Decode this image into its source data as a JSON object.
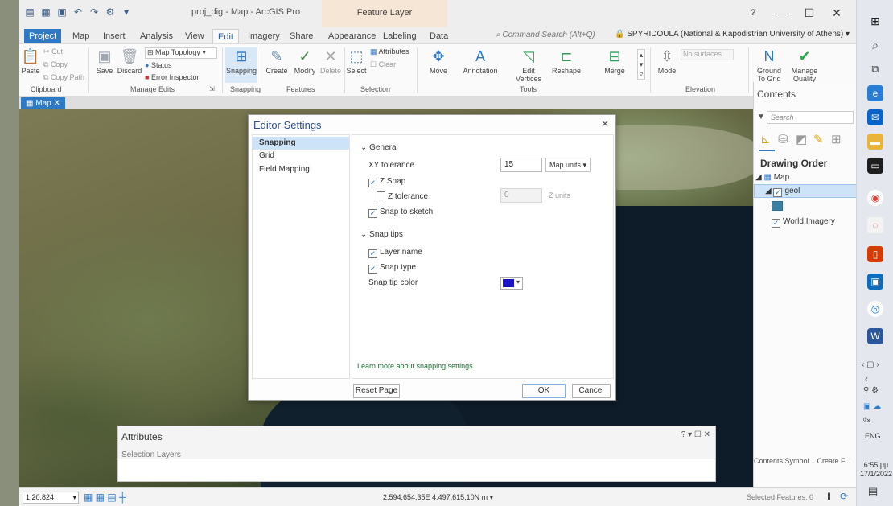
{
  "window": {
    "title": "proj_dig - Map - ArcGIS Pro",
    "context_title": "Feature Layer",
    "help": "?",
    "minimize": "—",
    "maximize": "☐",
    "close": "✕"
  },
  "ribbon_tabs": [
    "Project",
    "Map",
    "Insert",
    "Analysis",
    "View",
    "Edit",
    "Imagery",
    "Share",
    "Appearance",
    "Labeling",
    "Data"
  ],
  "command_search": "Command Search (Alt+Q)",
  "user": "SPYRIDOULA (National & Kapodistrian University of Athens) ▾",
  "ribbon": {
    "clipboard": {
      "paste": "Paste",
      "cut": "Cut",
      "copy": "Copy",
      "copy_path": "Copy Path",
      "group": "Clipboard"
    },
    "manage_edits": {
      "save": "Save",
      "discard": "Discard",
      "map_topology": "Map Topology",
      "status": "Status",
      "error_inspector": "Error Inspector",
      "group": "Manage Edits"
    },
    "snapping": {
      "label": "Snapping",
      "group": "Snapping"
    },
    "features": {
      "create": "Create",
      "modify": "Modify",
      "delete": "Delete",
      "group": "Features"
    },
    "selection": {
      "select": "Select",
      "attributes": "Attributes",
      "clear": "Clear",
      "group": "Selection"
    },
    "tools": {
      "move": "Move",
      "annotation": "Annotation",
      "edit_vertices": "Edit Vertices",
      "reshape": "Reshape",
      "merge": "Merge",
      "group": "Tools"
    },
    "elevation": {
      "mode": "Mode",
      "surfaces": "No surfaces",
      "group": "Elevation"
    },
    "ground_to_grid": "Ground To Grid",
    "manage_quality": "Manage Quality"
  },
  "view_tab": "Map",
  "dialog": {
    "title": "Editor Settings",
    "nav": [
      "Snapping",
      "Grid",
      "Field Mapping"
    ],
    "general_header": "General",
    "xy_tolerance_label": "XY tolerance",
    "xy_tolerance_value": "15",
    "xy_units": "Map units",
    "z_snap": "Z Snap",
    "z_tolerance_label": "Z tolerance",
    "z_tolerance_value": "0",
    "z_units": "Z units",
    "snap_to_sketch": "Snap to sketch",
    "snap_tips_header": "Snap tips",
    "layer_name": "Layer name",
    "snap_type": "Snap type",
    "snap_tip_color": "Snap tip color",
    "snap_tip_color_hex": "#1a14c8",
    "learn_more": "Learn more about snapping settings.",
    "reset": "Reset Page",
    "ok": "OK",
    "cancel": "Cancel"
  },
  "attributes_pane": {
    "title": "Attributes",
    "tabs": "Selection   Layers",
    "controls": "? ▾ ☐ ✕"
  },
  "contents": {
    "title": "Contents",
    "search_placeholder": "Search",
    "drawing_order": "Drawing Order",
    "map": "Map",
    "geol": "geol",
    "world_imagery": "World Imagery",
    "tabs": "Contents   Symbol...   Create F..."
  },
  "status": {
    "scale": "1:20.824",
    "coords": "2.594.654,35E 4.497.615,10N m ▾",
    "selected_features": "Selected Features: 0"
  },
  "taskbar": {
    "lang": "ENG",
    "time": "6:55 μμ",
    "date": "17/1/2022"
  }
}
